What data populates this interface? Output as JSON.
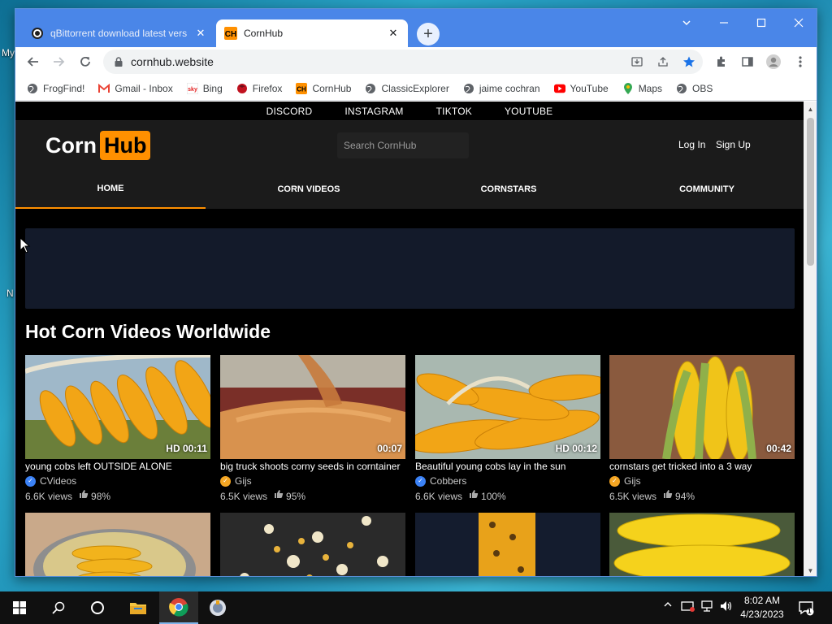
{
  "desktop": {
    "edge_labels": [
      "My",
      "N"
    ]
  },
  "browser": {
    "tabs": [
      {
        "title": "qBittorrent download latest vers",
        "close": "✕"
      },
      {
        "title": "CornHub",
        "close": "✕"
      }
    ],
    "new_tab": "+",
    "url": "cornhub.website",
    "bookmarks": [
      {
        "label": "FrogFind!",
        "icon": "globe-icon"
      },
      {
        "label": "Gmail - Inbox",
        "icon": "gmail-icon"
      },
      {
        "label": "Bing",
        "icon": "bing-icon"
      },
      {
        "label": "Firefox",
        "icon": "firefox-icon"
      },
      {
        "label": "CornHub",
        "icon": "cornhub-icon"
      },
      {
        "label": "ClassicExplorer",
        "icon": "globe-icon"
      },
      {
        "label": "jaime cochran",
        "icon": "globe-icon"
      },
      {
        "label": "YouTube",
        "icon": "youtube-icon"
      },
      {
        "label": "Maps",
        "icon": "maps-icon"
      },
      {
        "label": "OBS",
        "icon": "globe-icon"
      }
    ]
  },
  "site": {
    "social_links": [
      "DISCORD",
      "INSTAGRAM",
      "TIKTOK",
      "YOUTUBE"
    ],
    "logo": {
      "part1": "Corn",
      "part2": "Hub"
    },
    "search_placeholder": "Search CornHub",
    "auth": {
      "login": "Log In",
      "signup": "Sign Up"
    },
    "nav": [
      "HOME",
      "CORN VIDEOS",
      "CORNSTARS",
      "COMMUNITY"
    ],
    "section_title": "Hot Corn Videos Worldwide",
    "videos": [
      {
        "title": "young cobs left OUTSIDE ALONE",
        "duration": "HD 00:11",
        "channel": "CVideos",
        "views": "6.6K views",
        "rating": "98%",
        "badge_color": "#3b82f6"
      },
      {
        "title": "big truck shoots corny seeds in corntainer",
        "duration": "00:07",
        "channel": "Gijs",
        "views": "6.5K views",
        "rating": "95%",
        "badge_color": "#f5a623"
      },
      {
        "title": "Beautiful young cobs lay in the sun",
        "duration": "HD 00:12",
        "channel": "Cobbers",
        "views": "6.6K views",
        "rating": "100%",
        "badge_color": "#3b82f6"
      },
      {
        "title": "cornstars get tricked into a 3 way",
        "duration": "00:42",
        "channel": "Gijs",
        "views": "6.5K views",
        "rating": "94%",
        "badge_color": "#f5a623"
      }
    ]
  },
  "taskbar": {
    "time": "8:02 AM",
    "date": "4/23/2023",
    "notification_count": "1"
  },
  "colors": {
    "accent": "#ff9000",
    "chrome_blue": "#4a86e8",
    "header_bg": "#1b1b1b"
  }
}
